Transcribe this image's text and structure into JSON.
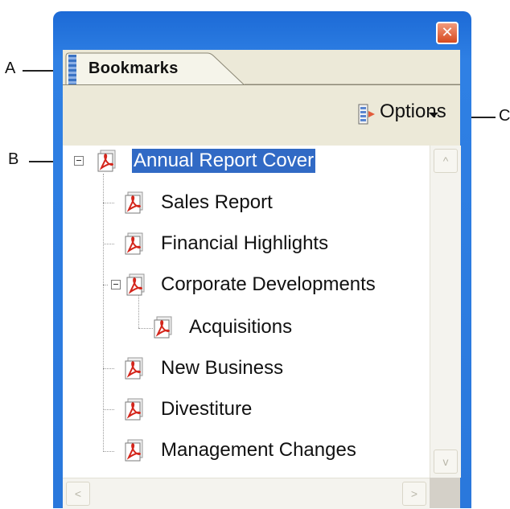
{
  "callouts": {
    "a": "A",
    "b": "B",
    "c": "C"
  },
  "panel": {
    "tab_label": "Bookmarks",
    "close_glyph": "✕",
    "options_label": "Options"
  },
  "bookmarks": [
    {
      "label": "Annual Report Cover",
      "selected": true,
      "level": 0,
      "expanded": true
    },
    {
      "label": "Sales Report",
      "level": 1
    },
    {
      "label": "Financial Highlights",
      "level": 1
    },
    {
      "label": "Corporate Developments",
      "level": 1,
      "expanded": true
    },
    {
      "label": "Acquisitions",
      "level": 2
    },
    {
      "label": "New Business",
      "level": 1
    },
    {
      "label": "Divestiture",
      "level": 1
    },
    {
      "label": "Management Changes",
      "level": 1
    }
  ],
  "scroll": {
    "up": "^",
    "down": "v",
    "left": "<",
    "right": ">"
  },
  "colors": {
    "titlebar": "#2a78dc",
    "selection": "#316ac5",
    "panel_bg": "#ece9d8",
    "pdf_red": "#d4261c"
  }
}
